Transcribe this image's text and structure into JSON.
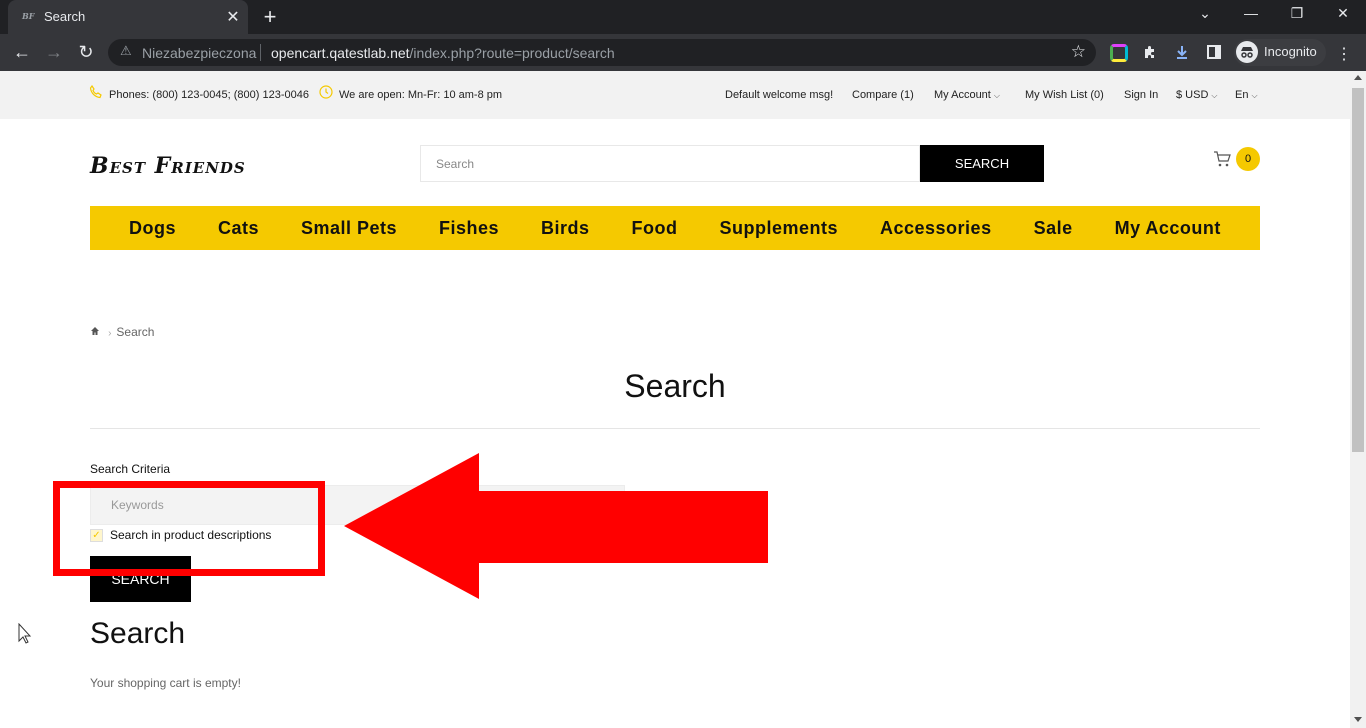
{
  "browser": {
    "tab_title": "Search",
    "tab_favicon": "BF",
    "tab_close": "✕",
    "new_tab": "+",
    "window_controls": {
      "dropdown": "⌄",
      "minimize": "—",
      "restore": "❐",
      "close": "✕"
    },
    "nav": {
      "back": "←",
      "forward": "→",
      "reload": "↻"
    },
    "security_icon": "⚠",
    "security_label": "Niezabezpieczona",
    "url_host": "opencart.qatestlab.net",
    "url_path": "/index.php?route=product/search",
    "bookmark": "☆",
    "extensions": [
      "color-extension-icon",
      "puzzle-icon",
      "download-icon",
      "side-panel-icon"
    ],
    "incognito_label": "Incognito",
    "menu": "⋮"
  },
  "topbar": {
    "phones": "Phones: (800) 123-0045; (800) 123-0046",
    "hours": "We are open: Mn-Fr: 10 am-8 pm",
    "welcome": "Default welcome msg!",
    "compare": "Compare (1)",
    "my_account": "My Account",
    "wishlist": "My Wish List (0)",
    "sign_in": "Sign In",
    "currency": "$ USD",
    "language": "En"
  },
  "header": {
    "logo": "Best Friends",
    "search_placeholder": "Search",
    "search_button": "SEARCH",
    "cart_count": "0"
  },
  "menu": [
    "Dogs",
    "Cats",
    "Small Pets",
    "Fishes",
    "Birds",
    "Food",
    "Supplements",
    "Accessories",
    "Sale",
    "My Account"
  ],
  "breadcrumb": {
    "current": "Search"
  },
  "page": {
    "title": "Search",
    "criteria_label": "Search Criteria",
    "keywords_placeholder": "Keywords",
    "descriptions_label": "Search in product descriptions",
    "submit_label": "SEARCH",
    "results_heading": "Search",
    "cart_empty": "Your shopping cart is empty!"
  },
  "colors": {
    "accent": "#f5c900",
    "annotation": "#ff0000",
    "chrome_dark": "#202124",
    "chrome_toolbar": "#35363a"
  }
}
